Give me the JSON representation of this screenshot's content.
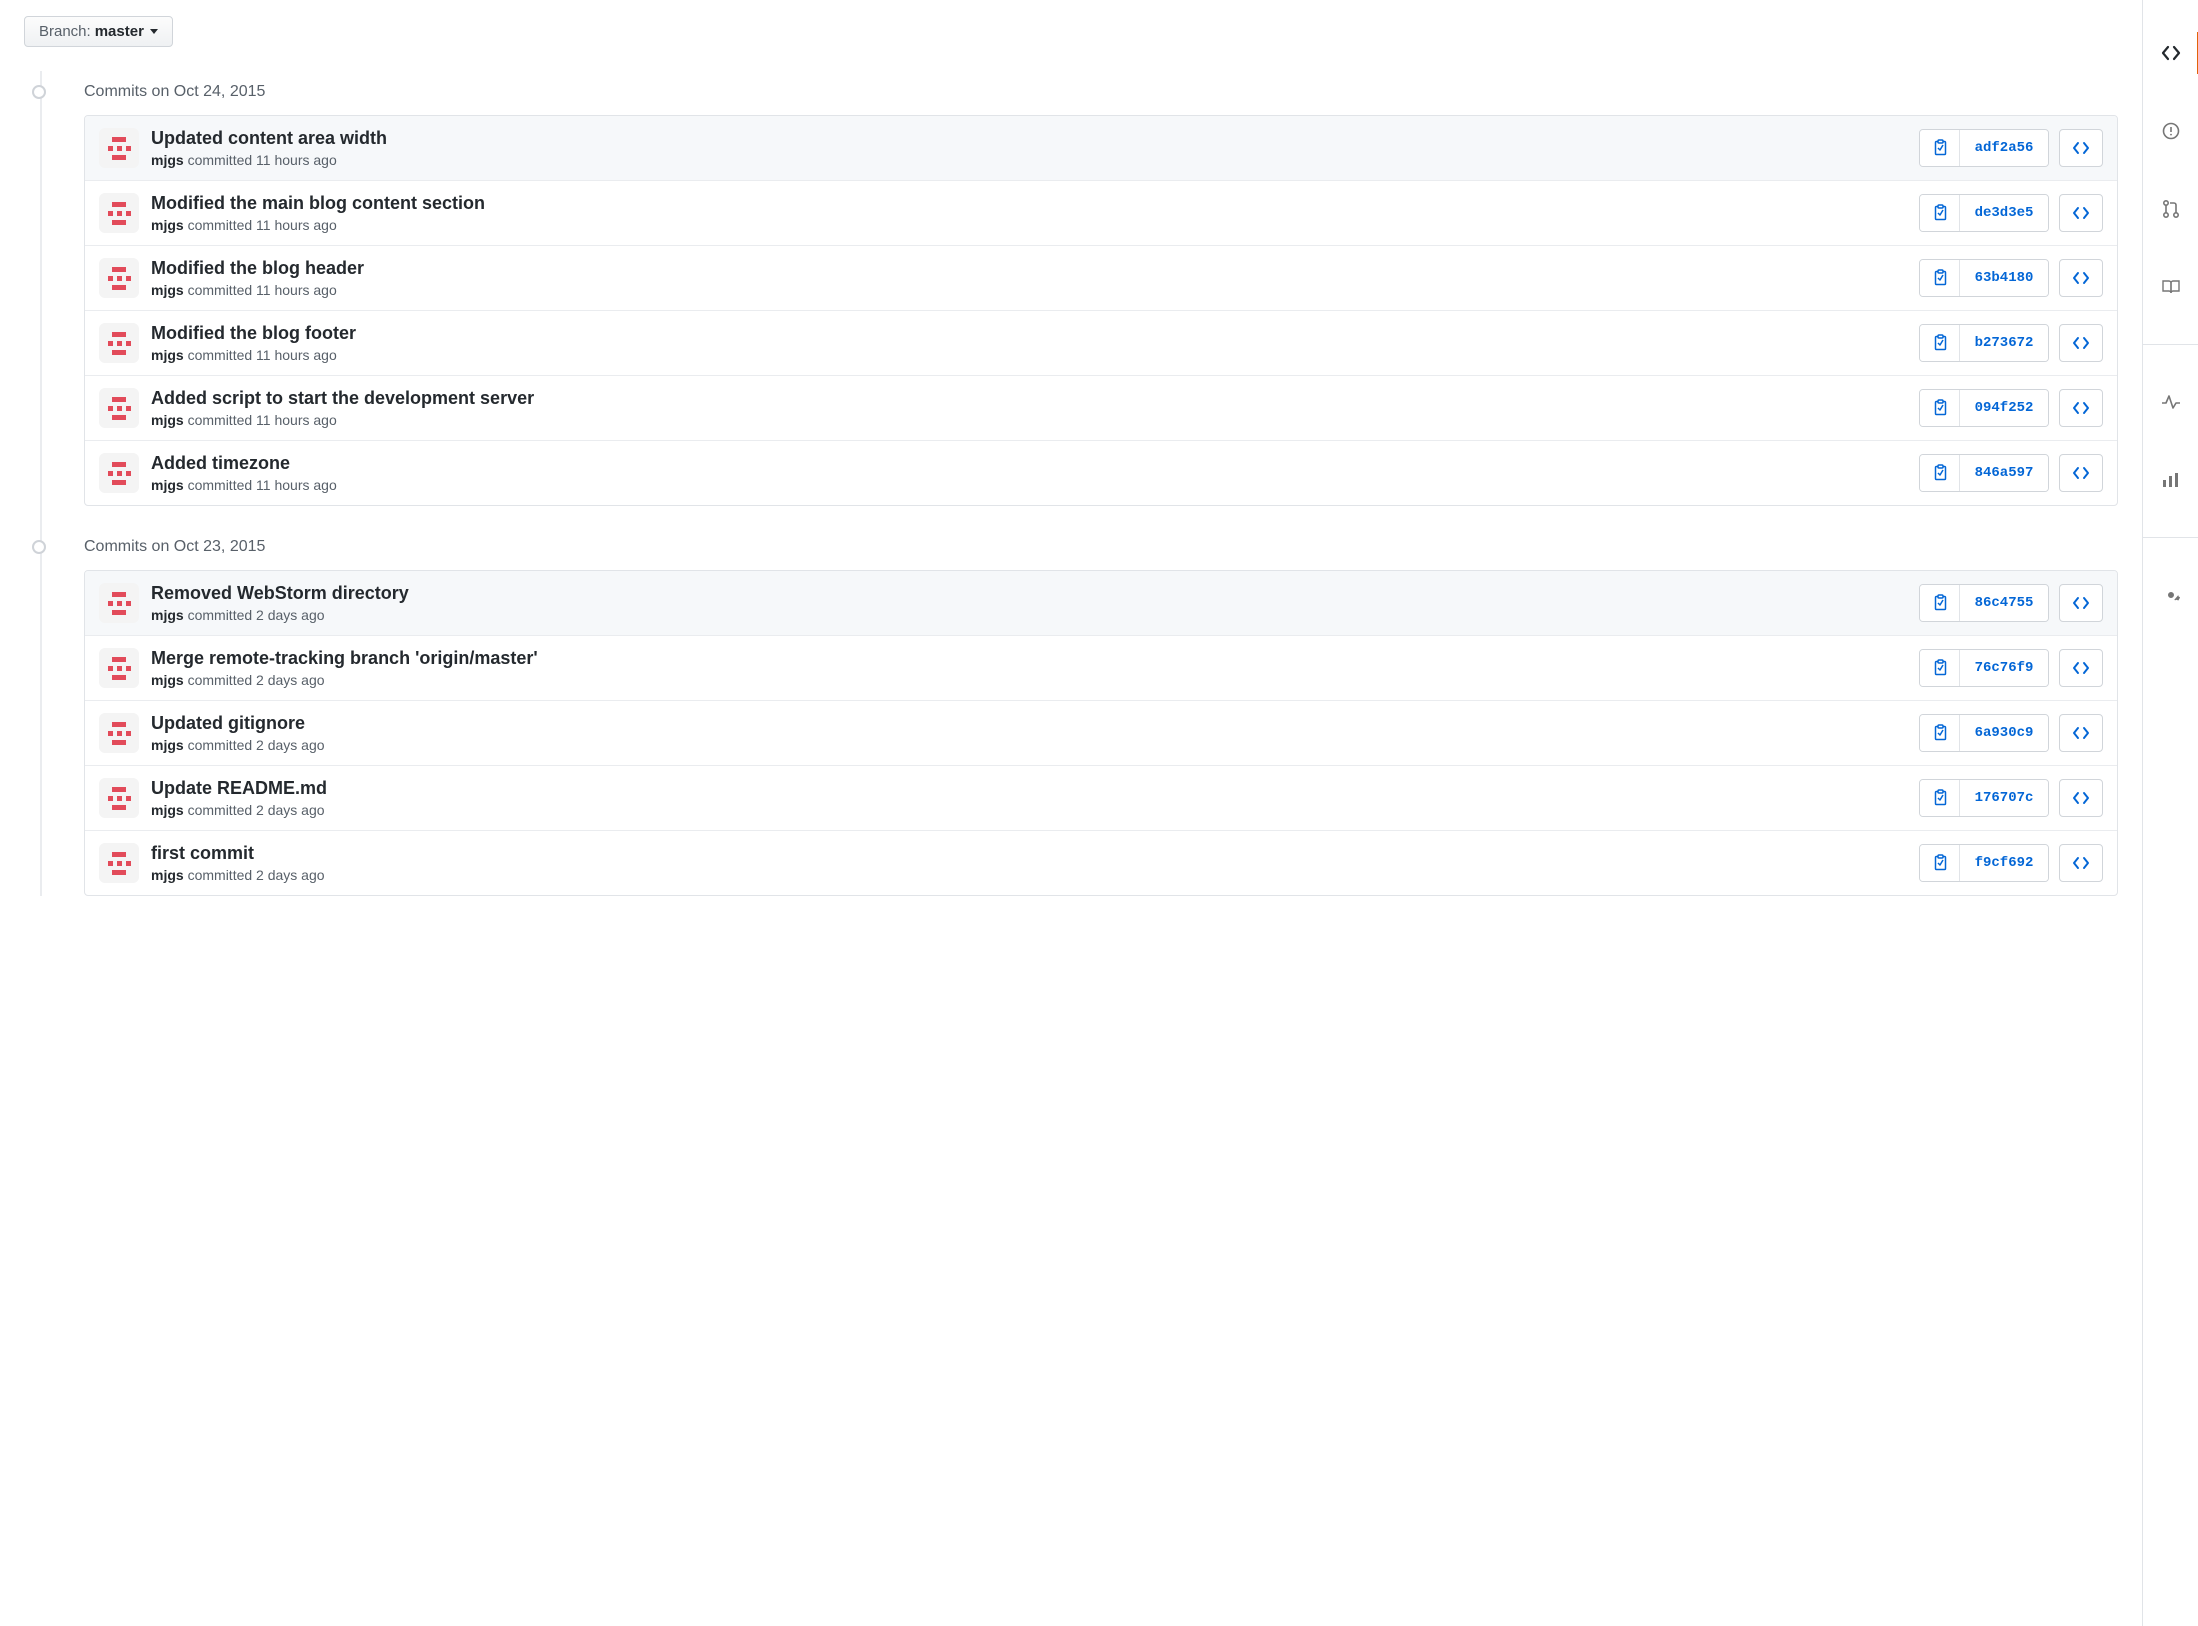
{
  "branch_selector": {
    "label": "Branch:",
    "current": "master"
  },
  "groups": [
    {
      "title": "Commits on Oct 24, 2015",
      "commits": [
        {
          "title": "Updated content area width",
          "author": "mjgs",
          "when": "committed 11 hours ago",
          "hash": "adf2a56"
        },
        {
          "title": "Modified the main blog content section",
          "author": "mjgs",
          "when": "committed 11 hours ago",
          "hash": "de3d3e5"
        },
        {
          "title": "Modified the blog header",
          "author": "mjgs",
          "when": "committed 11 hours ago",
          "hash": "63b4180"
        },
        {
          "title": "Modified the blog footer",
          "author": "mjgs",
          "when": "committed 11 hours ago",
          "hash": "b273672"
        },
        {
          "title": "Added script to start the development server",
          "author": "mjgs",
          "when": "committed 11 hours ago",
          "hash": "094f252"
        },
        {
          "title": "Added timezone",
          "author": "mjgs",
          "when": "committed 11 hours ago",
          "hash": "846a597"
        }
      ]
    },
    {
      "title": "Commits on Oct 23, 2015",
      "commits": [
        {
          "title": "Removed WebStorm directory",
          "author": "mjgs",
          "when": "committed 2 days ago",
          "hash": "86c4755"
        },
        {
          "title": "Merge remote-tracking branch 'origin/master'",
          "author": "mjgs",
          "when": "committed 2 days ago",
          "hash": "76c76f9"
        },
        {
          "title": "Updated gitignore",
          "author": "mjgs",
          "when": "committed 2 days ago",
          "hash": "6a930c9"
        },
        {
          "title": "Update README.md",
          "author": "mjgs",
          "when": "committed 2 days ago",
          "hash": "176707c"
        },
        {
          "title": "first commit",
          "author": "mjgs",
          "when": "committed 2 days ago",
          "hash": "f9cf692"
        }
      ]
    }
  ],
  "side_nav": {
    "code": "Code",
    "issues": "Issues",
    "pulls": "Pull requests",
    "wiki": "Wiki",
    "pulse": "Pulse",
    "graphs": "Graphs",
    "settings": "Settings"
  }
}
